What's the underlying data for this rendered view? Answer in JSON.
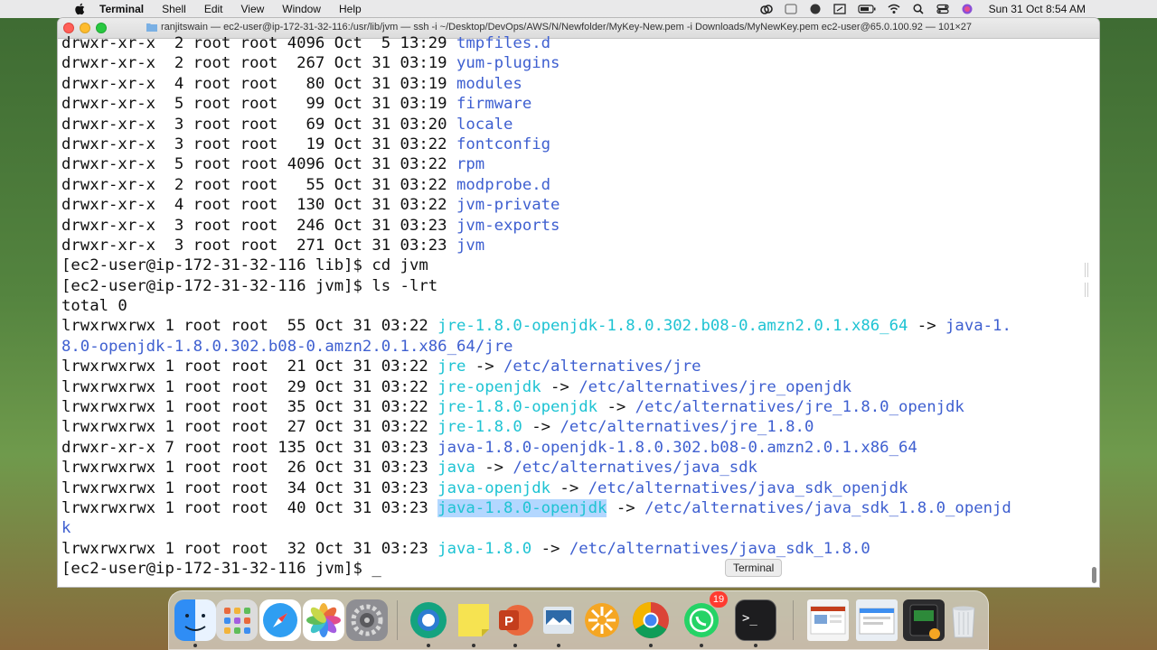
{
  "menubar": {
    "app_name": "Terminal",
    "items": [
      "Shell",
      "Edit",
      "View",
      "Window",
      "Help"
    ],
    "clock": "Sun 31 Oct  8:54 AM",
    "status_icons": [
      "creative-cloud-icon",
      "control-icon",
      "safari-pin-icon",
      "display-icon",
      "battery-icon",
      "wifi-icon",
      "spotlight-search-icon",
      "control-center-icon",
      "siri-icon"
    ]
  },
  "window": {
    "title": "ranjitswain — ec2-user@ip-172-31-32-116:/usr/lib/jvm — ssh -i ~/Desktop/DevOps/AWS/N/Newfolder/MyKey-New.pem -i Downloads/MyNewKey.pem ec2-user@65.0.100.92 — 101×27"
  },
  "terminal": {
    "lines": [
      [
        {
          "t": "drwxr-xr-x  2 root root 4096 Oct  5 13:29 "
        },
        {
          "t": "tmpfiles.d",
          "c": "blue"
        }
      ],
      [
        {
          "t": "drwxr-xr-x  2 root root  267 Oct 31 03:19 "
        },
        {
          "t": "yum-plugins",
          "c": "blue"
        }
      ],
      [
        {
          "t": "drwxr-xr-x  4 root root   80 Oct 31 03:19 "
        },
        {
          "t": "modules",
          "c": "blue"
        }
      ],
      [
        {
          "t": "drwxr-xr-x  5 root root   99 Oct 31 03:19 "
        },
        {
          "t": "firmware",
          "c": "blue"
        }
      ],
      [
        {
          "t": "drwxr-xr-x  3 root root   69 Oct 31 03:20 "
        },
        {
          "t": "locale",
          "c": "blue"
        }
      ],
      [
        {
          "t": "drwxr-xr-x  3 root root   19 Oct 31 03:22 "
        },
        {
          "t": "fontconfig",
          "c": "blue"
        }
      ],
      [
        {
          "t": "drwxr-xr-x  5 root root 4096 Oct 31 03:22 "
        },
        {
          "t": "rpm",
          "c": "blue"
        }
      ],
      [
        {
          "t": "drwxr-xr-x  2 root root   55 Oct 31 03:22 "
        },
        {
          "t": "modprobe.d",
          "c": "blue"
        }
      ],
      [
        {
          "t": "drwxr-xr-x  4 root root  130 Oct 31 03:22 "
        },
        {
          "t": "jvm-private",
          "c": "blue"
        }
      ],
      [
        {
          "t": "drwxr-xr-x  3 root root  246 Oct 31 03:23 "
        },
        {
          "t": "jvm-exports",
          "c": "blue"
        }
      ],
      [
        {
          "t": "drwxr-xr-x  3 root root  271 Oct 31 03:23 "
        },
        {
          "t": "jvm",
          "c": "blue"
        }
      ],
      [
        {
          "t": "[ec2-user@ip-172-31-32-116 lib]$ cd jvm"
        }
      ],
      [
        {
          "t": "[ec2-user@ip-172-31-32-116 jvm]$ ls -lrt"
        }
      ],
      [
        {
          "t": "total 0"
        }
      ],
      [
        {
          "t": "lrwxrwxrwx 1 root root  55 Oct 31 03:22 "
        },
        {
          "t": "jre-1.8.0-openjdk-1.8.0.302.b08-0.amzn2.0.1.x86_64",
          "c": "cyan"
        },
        {
          "t": " -> "
        },
        {
          "t": "java-1.",
          "c": "blue"
        }
      ],
      [
        {
          "t": "8.0-openjdk-1.8.0.302.b08-0.amzn2.0.1.x86_64/jre",
          "c": "blue"
        }
      ],
      [
        {
          "t": "lrwxrwxrwx 1 root root  21 Oct 31 03:22 "
        },
        {
          "t": "jre",
          "c": "cyan"
        },
        {
          "t": " -> "
        },
        {
          "t": "/etc/alternatives/jre",
          "c": "blue"
        }
      ],
      [
        {
          "t": "lrwxrwxrwx 1 root root  29 Oct 31 03:22 "
        },
        {
          "t": "jre-openjdk",
          "c": "cyan"
        },
        {
          "t": " -> "
        },
        {
          "t": "/etc/alternatives/jre_openjdk",
          "c": "blue"
        }
      ],
      [
        {
          "t": "lrwxrwxrwx 1 root root  35 Oct 31 03:22 "
        },
        {
          "t": "jre-1.8.0-openjdk",
          "c": "cyan"
        },
        {
          "t": " -> "
        },
        {
          "t": "/etc/alternatives/jre_1.8.0_openjdk",
          "c": "blue"
        }
      ],
      [
        {
          "t": "lrwxrwxrwx 1 root root  27 Oct 31 03:22 "
        },
        {
          "t": "jre-1.8.0",
          "c": "cyan"
        },
        {
          "t": " -> "
        },
        {
          "t": "/etc/alternatives/jre_1.8.0",
          "c": "blue"
        }
      ],
      [
        {
          "t": "drwxr-xr-x 7 root root 135 Oct 31 03:23 "
        },
        {
          "t": "java-1.8.0-openjdk-1.8.0.302.b08-0.amzn2.0.1.x86_64",
          "c": "blue"
        }
      ],
      [
        {
          "t": "lrwxrwxrwx 1 root root  26 Oct 31 03:23 "
        },
        {
          "t": "java",
          "c": "cyan"
        },
        {
          "t": " -> "
        },
        {
          "t": "/etc/alternatives/java_sdk",
          "c": "blue"
        }
      ],
      [
        {
          "t": "lrwxrwxrwx 1 root root  34 Oct 31 03:23 "
        },
        {
          "t": "java-openjdk",
          "c": "cyan"
        },
        {
          "t": " -> "
        },
        {
          "t": "/etc/alternatives/java_sdk_openjdk",
          "c": "blue"
        }
      ],
      [
        {
          "t": "lrwxrwxrwx 1 root root  40 Oct 31 03:23 "
        },
        {
          "t": "java-1.8.0-openjdk",
          "c": "cyan",
          "sel": true
        },
        {
          "t": " -> "
        },
        {
          "t": "/etc/alternatives/java_sdk_1.8.0_openjd",
          "c": "blue"
        }
      ],
      [
        {
          "t": "k",
          "c": "blue"
        }
      ],
      [
        {
          "t": "lrwxrwxrwx 1 root root  32 Oct 31 03:23 "
        },
        {
          "t": "java-1.8.0",
          "c": "cyan"
        },
        {
          "t": " -> "
        },
        {
          "t": "/etc/alternatives/java_sdk_1.8.0",
          "c": "blue"
        }
      ],
      [
        {
          "t": "[ec2-user@ip-172-31-32-116 jvm]$ _"
        }
      ]
    ]
  },
  "tooltip": "Terminal",
  "dock": {
    "items": [
      "finder-icon",
      "launchpad-icon",
      "safari-icon",
      "photos-icon",
      "system-preferences-icon",
      "webex-icon",
      "stickies-icon",
      "powerpoint-icon",
      "preview-icon",
      "squash-icon",
      "chrome-icon",
      "whatsapp-icon",
      "terminal-icon",
      "recent-document-icon",
      "recent-window-icon",
      "activity-monitor-icon",
      "trash-icon"
    ],
    "whatsapp_badge": "19"
  },
  "colors": {
    "blue": "#3e5fd0",
    "cyan": "#1ec3d3",
    "selection": "#b3d7ff"
  }
}
